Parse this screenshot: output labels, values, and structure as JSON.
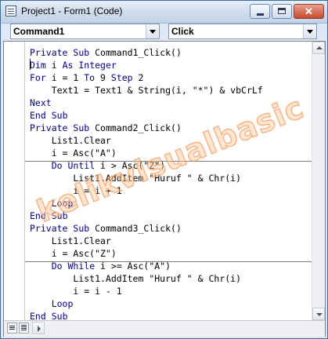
{
  "window": {
    "title": "Project1 - Form1 (Code)"
  },
  "title_buttons": {
    "close_glyph": "✕"
  },
  "combos": {
    "object": "Command1",
    "procedure": "Click"
  },
  "code": {
    "lines": [
      "Private Sub Command1_Click()",
      "Dim i As Integer",
      "For i = 1 To 9 Step 2",
      "    Text1 = Text1 & String(i, \"*\") & vbCrLf",
      "Next",
      "End Sub",
      "Private Sub Command2_Click()",
      "    List1.Clear",
      "    i = Asc(\"A\")",
      "    Do Until i > Asc(\"Z\")",
      "        List1.AddItem \"Huruf \" & Chr(i)",
      "        i = i + 1",
      "    Loop",
      "End Sub",
      "Private Sub Command3_Click()",
      "    List1.Clear",
      "    i = Asc(\"Z\")",
      "    Do While i >= Asc(\"A\")",
      "        List1.AddItem \"Huruf \" & Chr(i)",
      "        i = i - 1",
      "    Loop",
      "End Sub"
    ]
  },
  "watermark": "kelikvisualbasic",
  "colors": {
    "keyword": "#00008b",
    "text": "#000000",
    "title_bar": "#cfdcec",
    "close_button": "#c74a2d"
  }
}
